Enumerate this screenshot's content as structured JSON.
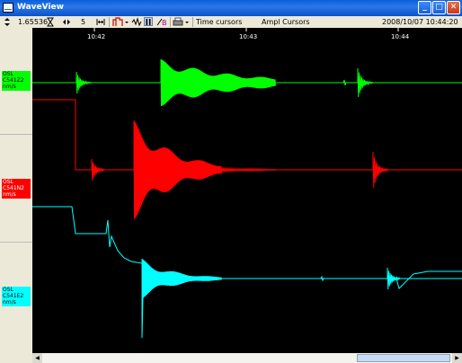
{
  "window": {
    "title": "WaveView"
  },
  "title_buttons": {
    "minimize": "_",
    "maximize": "□",
    "close": "✕"
  },
  "toolbar": {
    "scale_value": "1.65536",
    "step_value": "5",
    "time_cursors": "Time cursors",
    "ampl_cursors": "Ampl Cursors",
    "datetime": "2008/10/07 10:44:20",
    "icons": [
      "updown-arrows-icon",
      "time-scale-icon",
      "left-right-arrows-icon",
      "fit-icon",
      "filter-icon",
      "filter-dropdown-icon",
      "wave-icon",
      "pause-icon",
      "edit-icon",
      "print-icon",
      "print-dropdown-icon"
    ]
  },
  "time_axis": {
    "labels": [
      "10:42",
      "10:43",
      "10:44"
    ]
  },
  "channels": [
    {
      "line1": "OSL",
      "line2": "C541Z2",
      "line3": "nm/s",
      "color": "#00ff00",
      "text_color": "#000000"
    },
    {
      "line1": "OSL",
      "line2": "C541N2",
      "line3": "nm/s",
      "color": "#ff0000",
      "text_color": "#ffffff"
    },
    {
      "line1": "OSL",
      "line2": "C541E2",
      "line3": "nm/s",
      "color": "#00ffff",
      "text_color": "#000000"
    }
  ]
}
